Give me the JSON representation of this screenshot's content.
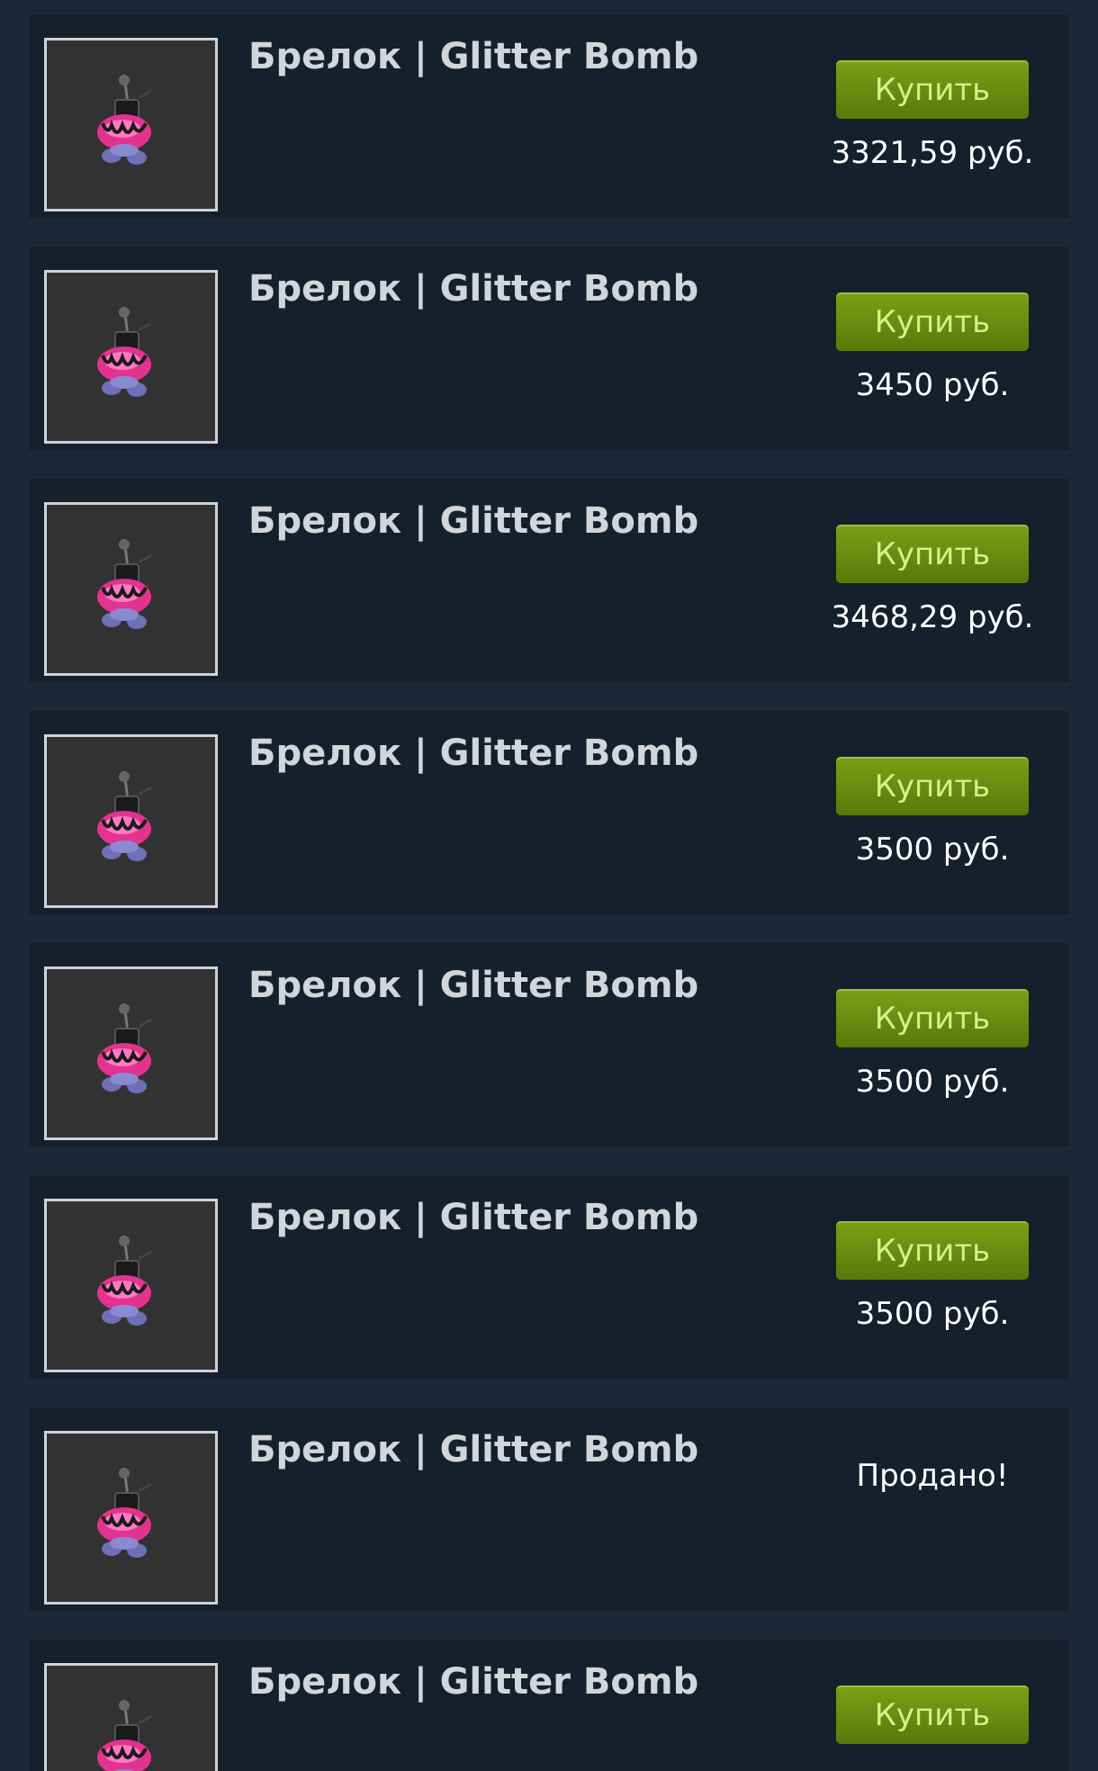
{
  "listings": [
    {
      "name": "Брелок | Glitter Bomb",
      "image": "glitter-bomb-charm-image",
      "buy_label": "Купить",
      "price": "3321,59 руб."
    },
    {
      "name": "Брелок | Glitter Bomb",
      "image": "glitter-bomb-charm-image",
      "buy_label": "Купить",
      "price": "3450 руб."
    },
    {
      "name": "Брелок | Glitter Bomb",
      "image": "glitter-bomb-charm-image",
      "buy_label": "Купить",
      "price": "3468,29 руб."
    },
    {
      "name": "Брелок | Glitter Bomb",
      "image": "glitter-bomb-charm-image",
      "buy_label": "Купить",
      "price": "3500 руб."
    },
    {
      "name": "Брелок | Glitter Bomb",
      "image": "glitter-bomb-charm-image",
      "buy_label": "Купить",
      "price": "3500 руб."
    },
    {
      "name": "Брелок | Glitter Bomb",
      "image": "glitter-bomb-charm-image",
      "buy_label": "Купить",
      "price": "3500 руб."
    },
    {
      "name": "Брелок | Glitter Bomb",
      "image": "glitter-bomb-charm-image",
      "status": "Продано!"
    },
    {
      "name": "Брелок | Glitter Bomb",
      "image": "glitter-bomb-charm-image",
      "buy_label": "Купить"
    }
  ],
  "colors": {
    "page_background": "#1c2838",
    "row_background": "#161f2c",
    "thumb_background": "#323232",
    "thumb_border": "#cfd3d8",
    "name_text": "#d2d5d9",
    "button_top": "#7aa115",
    "button_bottom": "#567a0a",
    "button_text": "#d8ef8a",
    "price_text": "#ffffff"
  }
}
